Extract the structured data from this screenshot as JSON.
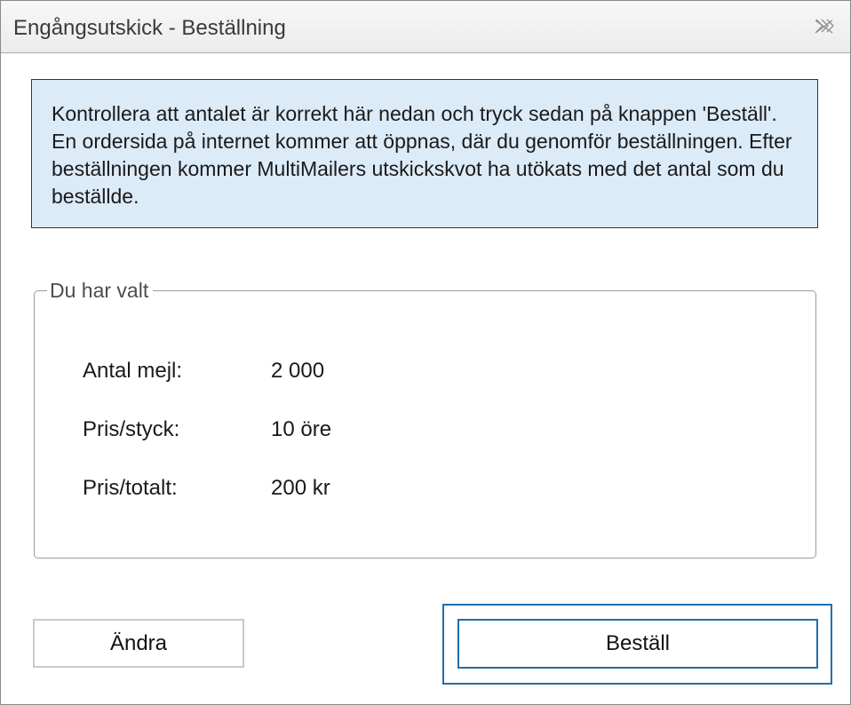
{
  "window": {
    "title": "Engångsutskick - Beställning",
    "close_icon": "close-icon"
  },
  "info": {
    "text": "Kontrollera att antalet är korrekt här nedan och tryck sedan på knappen 'Beställ'. En ordersida på internet kommer att öppnas, där du genomför beställningen. Efter beställningen kommer MultiMailers utskickskvot ha utökats med det antal som du beställde.",
    "background_color": "#dcebf8"
  },
  "selection": {
    "legend": "Du har valt",
    "rows": [
      {
        "label": "Antal mejl:",
        "value": "2 000"
      },
      {
        "label": "Pris/styck:",
        "value": "10 öre"
      },
      {
        "label": "Pris/totalt:",
        "value": "200 kr"
      }
    ]
  },
  "buttons": {
    "change_label": "Ändra",
    "order_label": "Beställ",
    "accent_color": "#1e6fb0"
  }
}
